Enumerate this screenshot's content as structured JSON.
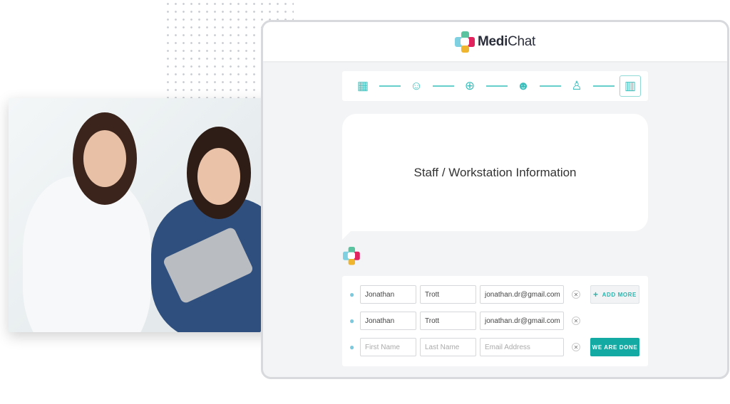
{
  "app": {
    "brand_bold": "Medi",
    "brand_light": "Chat"
  },
  "stepper": {
    "steps": [
      {
        "icon": "hospital-icon"
      },
      {
        "icon": "doctor-icon"
      },
      {
        "icon": "location-globe-icon"
      },
      {
        "icon": "support-agent-icon"
      },
      {
        "icon": "nurse-icon"
      },
      {
        "icon": "building-icon",
        "active": true
      }
    ]
  },
  "bubble": {
    "title": "Staff / Workstation Information"
  },
  "form": {
    "rows": [
      {
        "first": "Jonathan",
        "last": "Trott",
        "email": "jonathan.dr@gmail.com"
      },
      {
        "first": "Jonathan",
        "last": "Trott",
        "email": "jonathan.dr@gmail.com"
      }
    ],
    "placeholders": {
      "first": "First Name",
      "last": "Last Name",
      "email": "Email Address"
    },
    "add_more": "ADD MORE",
    "done": "WE ARE DONE"
  },
  "colors": {
    "accent": "#14aaa4",
    "logo_green": "#5cc3a0",
    "logo_red": "#e0245e",
    "logo_blue": "#7fd0e0",
    "logo_yellow": "#efb52e"
  }
}
